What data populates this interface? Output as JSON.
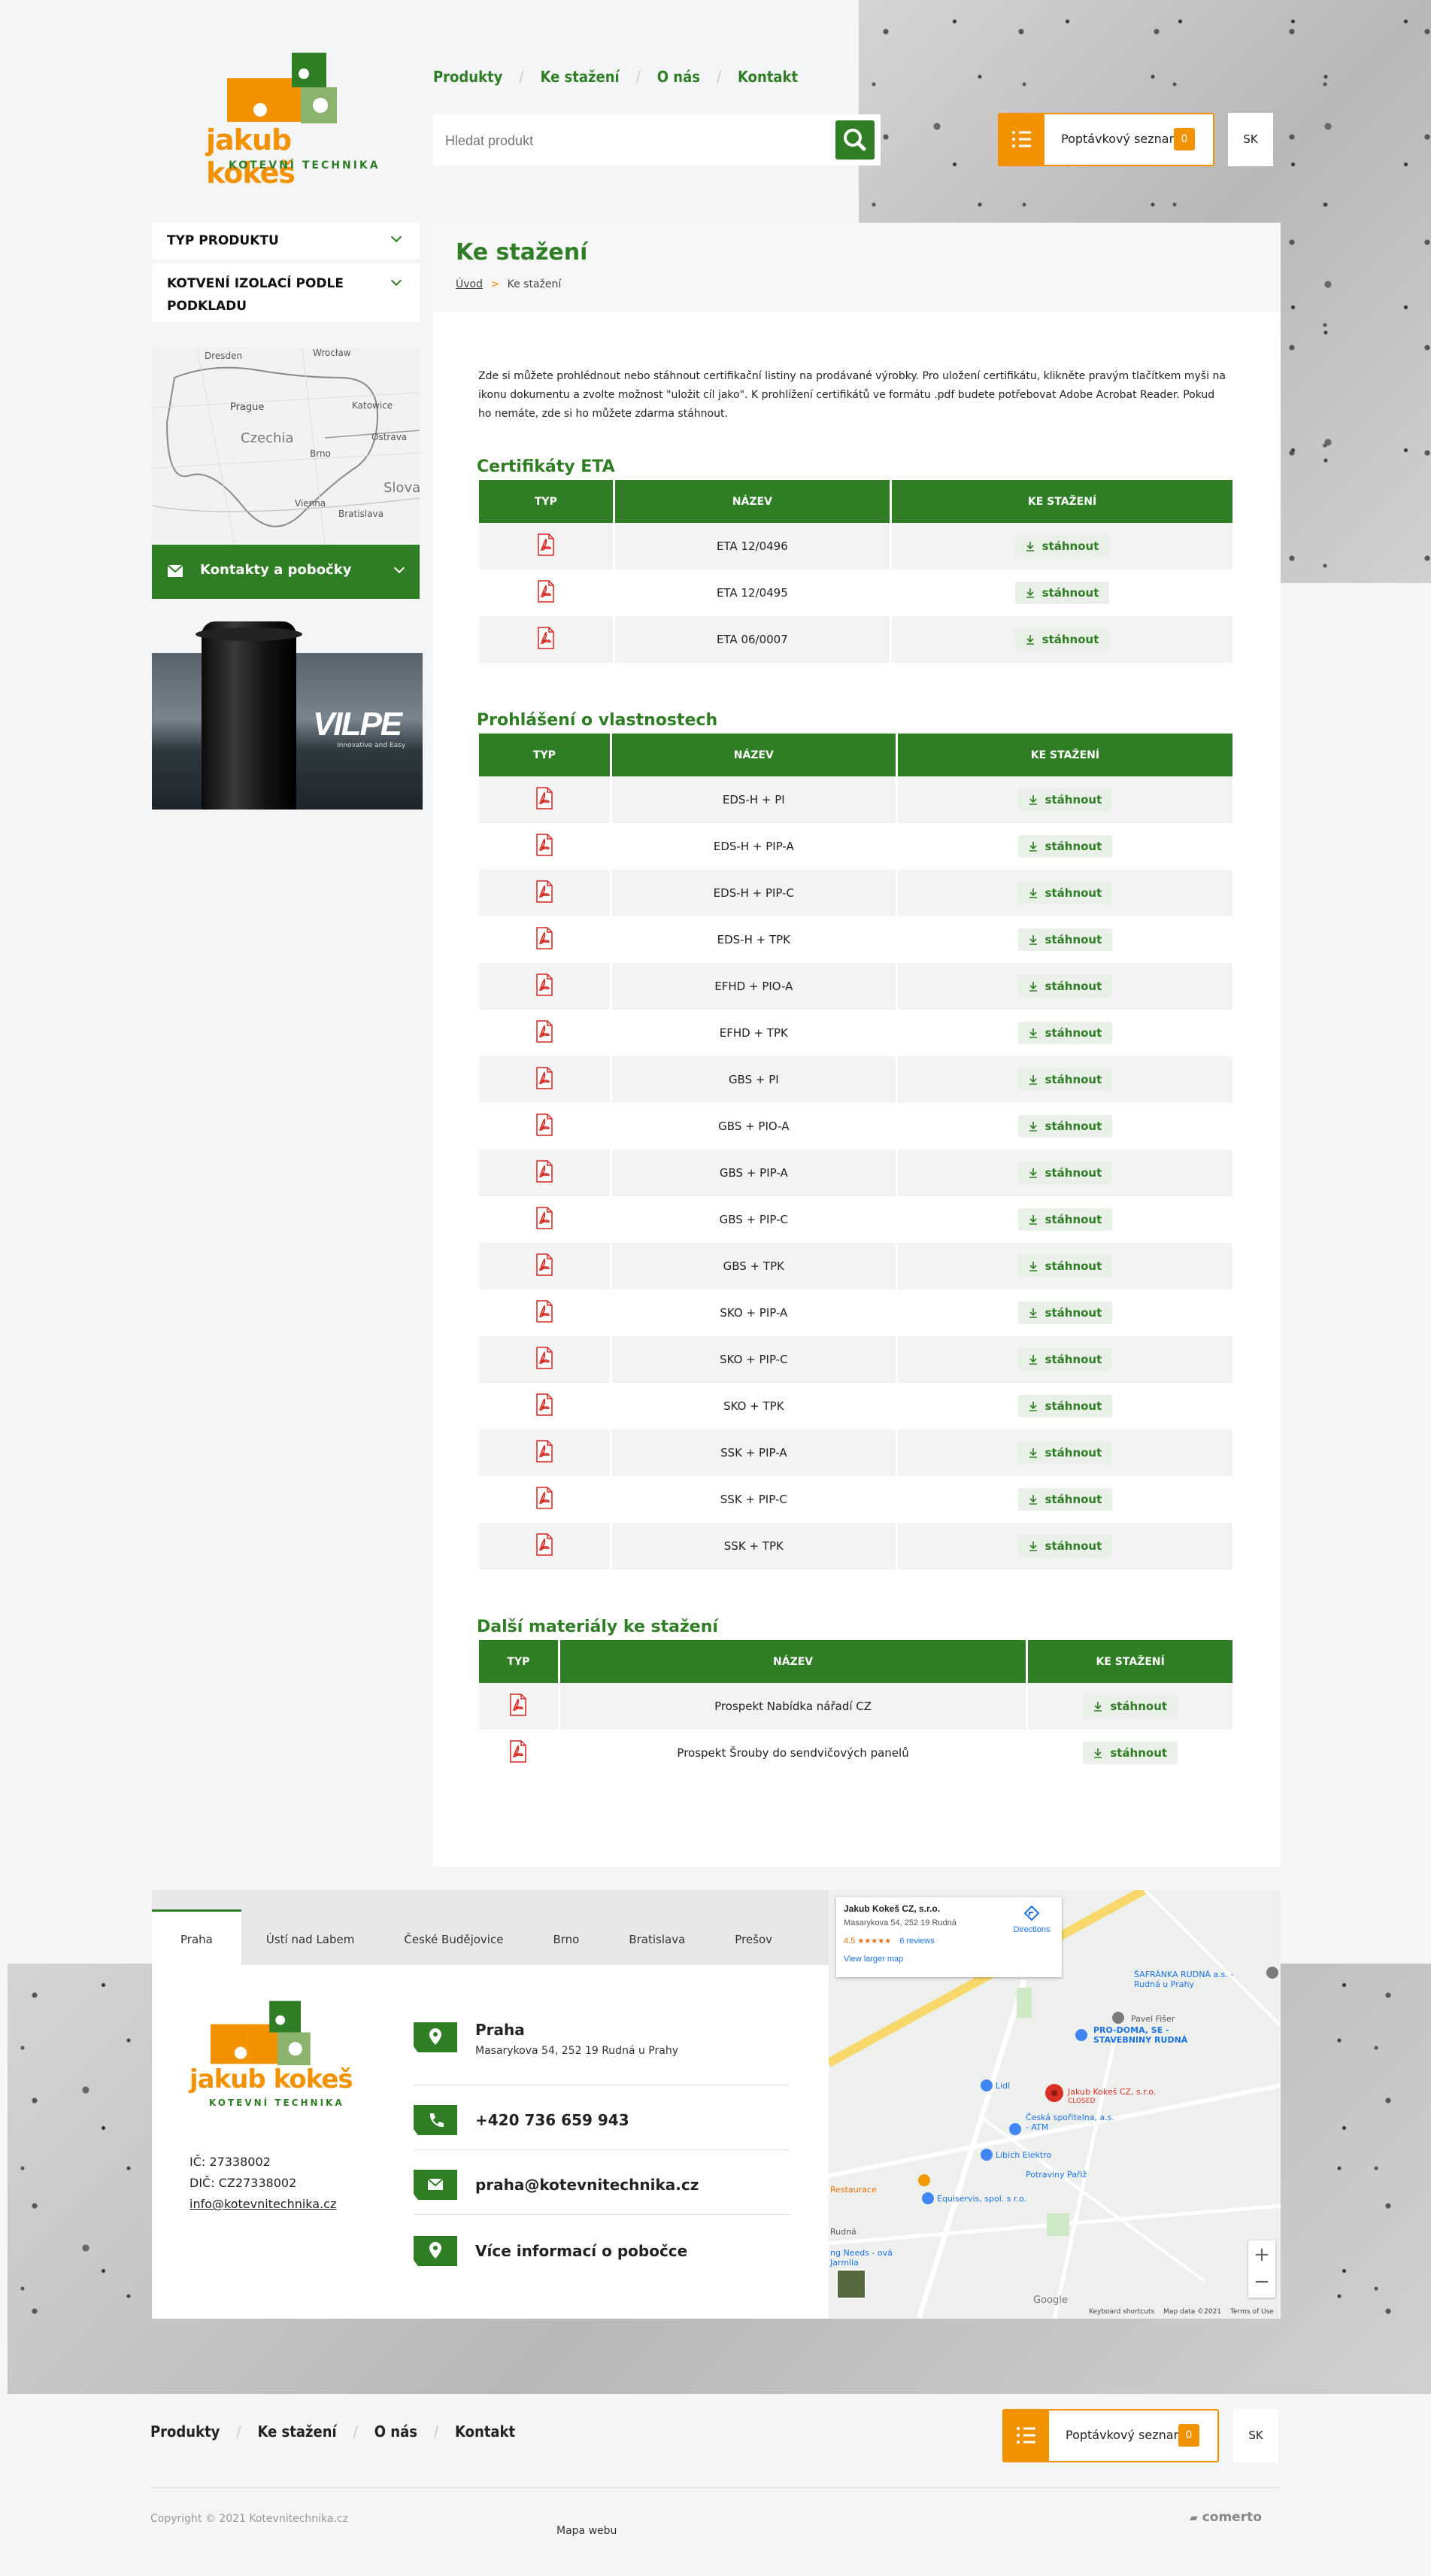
{
  "logo": {
    "name": "jakub kokeš",
    "tagline": "KOTEVNÍ TECHNIKA"
  },
  "header": {
    "nav": [
      "Produkty",
      "Ke stažení",
      "O nás",
      "Kontakt"
    ],
    "search_placeholder": "Hledat produkt",
    "quote_list_label": "Poptávkový seznam",
    "quote_count": "0",
    "lang": "SK"
  },
  "sidebar": {
    "items": [
      "TYP PRODUKTU",
      "KOTVENÍ IZOLACÍ PODLE PODKLADU"
    ],
    "contacts_label": "Kontakty a pobočky",
    "map_labels": [
      "Dresden",
      "Wrocław",
      "Prague",
      "Czechia",
      "Brno",
      "Katowice",
      "Ostrava",
      "Vienna",
      "Bratislava",
      "Slova"
    ],
    "banner_brand": "VILPE",
    "banner_tagline": "Innovative and Easy"
  },
  "page": {
    "title": "Ke stažení",
    "breadcrumb_home": "Úvod",
    "breadcrumb_current": "Ke stažení",
    "intro": "Zde si můžete prohlédnout nebo stáhnout certifikační listiny na prodávané výrobky. Pro uložení certifikátu, klikněte pravým tlačítkem myši na ikonu dokumentu a zvolte možnost \"uložit cíl jako\". K prohlížení certifikátů ve formátu .pdf budete potřebovat Adobe Acrobat Reader. Pokud ho nemáte, zde si ho můžete zdarma stáhnout."
  },
  "columns": {
    "type": "TYP",
    "name": "NÁZEV",
    "download": "KE STAŽENÍ"
  },
  "download_label": "stáhnout",
  "sections": [
    {
      "title": "Certifikáty ETA",
      "items": [
        "ETA 12/0496",
        "ETA 12/0495",
        "ETA 06/0007"
      ]
    },
    {
      "title": "Prohlášení o vlastnostech",
      "items": [
        "EDS-H + PI",
        "EDS-H + PIP-A",
        "EDS-H + PIP-C",
        "EDS-H + TPK",
        "EFHD + PIO-A",
        "EFHD + TPK",
        "GBS + PI",
        "GBS + PIO-A",
        "GBS + PIP-A",
        "GBS + PIP-C",
        "GBS + TPK",
        "SKO + PIP-A",
        "SKO + PIP-C",
        "SKO + TPK",
        "SSK + PIP-A",
        "SSK + PIP-C",
        "SSK + TPK"
      ]
    },
    {
      "title": "Další materiály ke stažení",
      "items": [
        "Prospekt Nabídka nářadí CZ",
        "Prospekt Šrouby do sendvičových panelů"
      ]
    }
  ],
  "branches": {
    "tabs": [
      "Praha",
      "Ústí nad Labem",
      "České Budějovice",
      "Brno",
      "Bratislava",
      "Prešov"
    ],
    "active": "Praha",
    "ic": "IČ: 27338002",
    "dic": "DIČ: CZ27338002",
    "email_link": "info@kotevnitechnika.cz",
    "city": "Praha",
    "address": "Masarykova 54, 252 19 Rudná u Prahy",
    "phone": "+420 736 659 943",
    "email": "praha@kotevnitechnika.cz",
    "more": "Více informací o pobočce"
  },
  "map_card": {
    "name": "Jakub Kokeš CZ, s.r.o.",
    "address": "Masarykova 54, 252 19 Rudná",
    "rating": "4.5",
    "stars": "★★★★★",
    "reviews": "6 reviews",
    "larger": "View larger map",
    "directions": "Directions",
    "labels": [
      "ŠAFRÁNKA RUDNÁ a.s. - Rudná u Prahy",
      "PRO-DOMA, SE - STAVEBNINY RUDNÁ",
      "Pavel Fišer",
      "Jakub Kokeš CZ, s.r.o.",
      "CLOSED",
      "Lidl",
      "Česká spořitelna, a.s. - ATM",
      "Libich Elektro",
      "Potraviny Pařiž",
      "Restaurace",
      "Equiservis, spol. s r.o.",
      "Rudná",
      "ng Needs - ová Jarmila"
    ],
    "footer_items": [
      "Keyboard shortcuts",
      "Map data ©2021",
      "Terms of Use"
    ],
    "google": "Google"
  },
  "footer": {
    "nav": [
      "Produkty",
      "Ke stažení",
      "O nás",
      "Kontakt"
    ],
    "copyright": "Copyright © 2021 Kotevnitechnika.cz",
    "sitemap": "Mapa webu",
    "brand": "comerto"
  },
  "colors": {
    "green": "#2f7d24",
    "orange": "#f39200",
    "pdf_red": "#d7261e"
  }
}
